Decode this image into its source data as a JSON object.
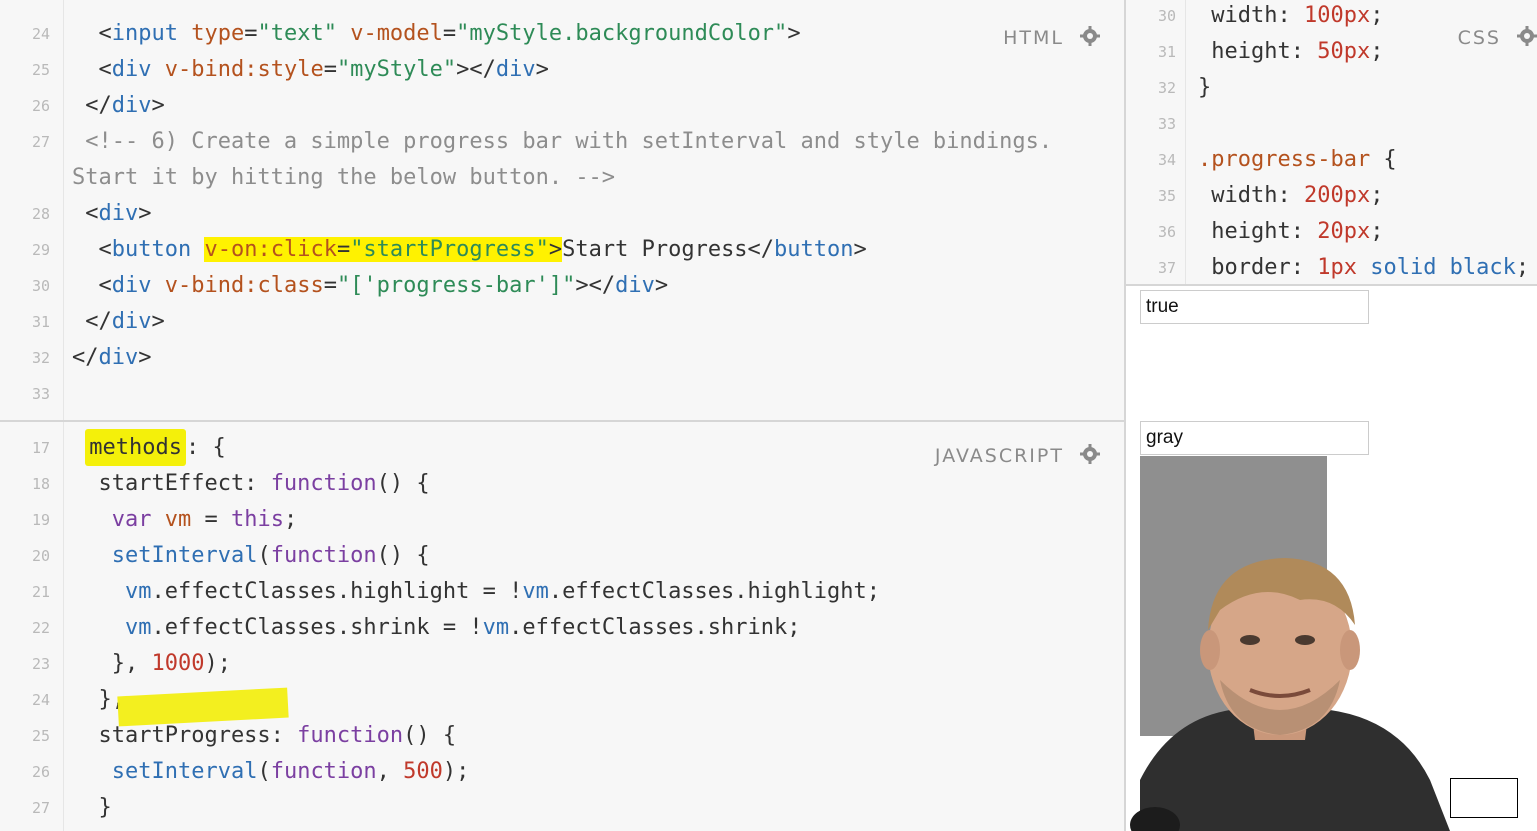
{
  "html_pane": {
    "label": "HTML",
    "lines": [
      {
        "num": "24",
        "segments": [
          {
            "t": "  <",
            "c": "tag"
          },
          {
            "t": "input",
            "c": "name"
          },
          {
            "t": " type",
            "c": "attr"
          },
          {
            "t": "=",
            "c": "plain"
          },
          {
            "t": "\"text\"",
            "c": "str"
          },
          {
            "t": " v-model",
            "c": "attr"
          },
          {
            "t": "=",
            "c": "plain"
          },
          {
            "t": "\"myStyle.backgroundColor\"",
            "c": "str"
          },
          {
            "t": ">",
            "c": "tag"
          }
        ]
      },
      {
        "num": "25",
        "segments": [
          {
            "t": "  <",
            "c": "tag"
          },
          {
            "t": "div",
            "c": "name"
          },
          {
            "t": " v-bind:style",
            "c": "attr"
          },
          {
            "t": "=",
            "c": "plain"
          },
          {
            "t": "\"myStyle\"",
            "c": "str"
          },
          {
            "t": "></",
            "c": "tag"
          },
          {
            "t": "div",
            "c": "name"
          },
          {
            "t": ">",
            "c": "tag"
          }
        ]
      },
      {
        "num": "26",
        "segments": [
          {
            "t": " </",
            "c": "tag"
          },
          {
            "t": "div",
            "c": "name"
          },
          {
            "t": ">",
            "c": "tag"
          }
        ]
      },
      {
        "num": "27",
        "segments": [
          {
            "t": " <!-- 6) Create a simple progress bar with setInterval and style bindings.",
            "c": "com"
          }
        ]
      },
      {
        "num": "",
        "segments": [
          {
            "t": "Start it by hitting the below button. -->",
            "c": "com"
          }
        ]
      },
      {
        "num": "28",
        "segments": [
          {
            "t": " <",
            "c": "tag"
          },
          {
            "t": "div",
            "c": "name"
          },
          {
            "t": ">",
            "c": "tag"
          }
        ]
      },
      {
        "num": "29",
        "segments": [
          {
            "t": "  <",
            "c": "tag"
          },
          {
            "t": "button",
            "c": "name"
          },
          {
            "t": " ",
            "c": "plain"
          },
          {
            "t": "v-on:click",
            "c": "attr",
            "hl": true
          },
          {
            "t": "=",
            "c": "plain",
            "hl": true
          },
          {
            "t": "\"startProgress\"",
            "c": "str",
            "hl": true
          },
          {
            "t": ">",
            "c": "tag",
            "hl": true
          },
          {
            "t": "Start Progress</",
            "c": "tag"
          },
          {
            "t": "button",
            "c": "name"
          },
          {
            "t": ">",
            "c": "tag"
          }
        ]
      },
      {
        "num": "30",
        "segments": [
          {
            "t": "  <",
            "c": "tag"
          },
          {
            "t": "div",
            "c": "name"
          },
          {
            "t": " v-bind:class",
            "c": "attr"
          },
          {
            "t": "=",
            "c": "plain"
          },
          {
            "t": "\"['progress-bar']\"",
            "c": "str"
          },
          {
            "t": "></",
            "c": "tag"
          },
          {
            "t": "div",
            "c": "name"
          },
          {
            "t": ">",
            "c": "tag"
          }
        ]
      },
      {
        "num": "31",
        "segments": [
          {
            "t": " </",
            "c": "tag"
          },
          {
            "t": "div",
            "c": "name"
          },
          {
            "t": ">",
            "c": "tag"
          }
        ]
      },
      {
        "num": "32",
        "segments": [
          {
            "t": "</",
            "c": "tag"
          },
          {
            "t": "div",
            "c": "name"
          },
          {
            "t": ">",
            "c": "tag"
          }
        ]
      },
      {
        "num": "33",
        "segments": []
      }
    ]
  },
  "js_pane": {
    "label": "JAVASCRIPT",
    "lines": [
      {
        "num": "17",
        "segments": [
          {
            "t": " ",
            "c": "plain"
          },
          {
            "t": "methods",
            "c": "plain",
            "hlm": true
          },
          {
            "t": ": {",
            "c": "plain"
          }
        ]
      },
      {
        "num": "18",
        "segments": [
          {
            "t": "  startEffect: ",
            "c": "plain"
          },
          {
            "t": "function",
            "c": "kw"
          },
          {
            "t": "() {",
            "c": "plain"
          }
        ]
      },
      {
        "num": "19",
        "segments": [
          {
            "t": "   ",
            "c": "plain"
          },
          {
            "t": "var",
            "c": "kw"
          },
          {
            "t": " vm",
            "c": "attr"
          },
          {
            "t": " = ",
            "c": "plain"
          },
          {
            "t": "this",
            "c": "kw"
          },
          {
            "t": ";",
            "c": "plain"
          }
        ]
      },
      {
        "num": "20",
        "segments": [
          {
            "t": "   ",
            "c": "plain"
          },
          {
            "t": "setInterval",
            "c": "var"
          },
          {
            "t": "(",
            "c": "plain"
          },
          {
            "t": "function",
            "c": "kw"
          },
          {
            "t": "() {",
            "c": "plain"
          }
        ]
      },
      {
        "num": "21",
        "segments": [
          {
            "t": "    ",
            "c": "plain"
          },
          {
            "t": "vm",
            "c": "var"
          },
          {
            "t": ".effectClasses.highlight = !",
            "c": "plain"
          },
          {
            "t": "vm",
            "c": "var"
          },
          {
            "t": ".effectClasses.highlight;",
            "c": "plain"
          }
        ]
      },
      {
        "num": "22",
        "segments": [
          {
            "t": "    ",
            "c": "plain"
          },
          {
            "t": "vm",
            "c": "var"
          },
          {
            "t": ".effectClasses.shrink = !",
            "c": "plain"
          },
          {
            "t": "vm",
            "c": "var"
          },
          {
            "t": ".effectClasses.shrink;",
            "c": "plain"
          }
        ]
      },
      {
        "num": "23",
        "segments": [
          {
            "t": "   }, ",
            "c": "plain"
          },
          {
            "t": "1000",
            "c": "num"
          },
          {
            "t": ");",
            "c": "plain"
          }
        ]
      },
      {
        "num": "24",
        "segments": [
          {
            "t": "  },",
            "c": "plain"
          }
        ]
      },
      {
        "num": "25",
        "segments": [
          {
            "t": "  startProgress: ",
            "c": "plain"
          },
          {
            "t": "function",
            "c": "kw"
          },
          {
            "t": "() {",
            "c": "plain"
          }
        ]
      },
      {
        "num": "26",
        "segments": [
          {
            "t": "   ",
            "c": "plain"
          },
          {
            "t": "setInterval",
            "c": "var"
          },
          {
            "t": "(",
            "c": "plain"
          },
          {
            "t": "function",
            "c": "kw"
          },
          {
            "t": ", ",
            "c": "plain"
          },
          {
            "t": "500",
            "c": "num"
          },
          {
            "t": ");",
            "c": "plain"
          }
        ]
      },
      {
        "num": "27",
        "segments": [
          {
            "t": "  }",
            "c": "plain"
          }
        ]
      }
    ]
  },
  "css_pane": {
    "label": "CSS",
    "lines": [
      {
        "num": "30",
        "segments": [
          {
            "t": " width: ",
            "c": "plain"
          },
          {
            "t": "100px",
            "c": "num"
          },
          {
            "t": ";",
            "c": "plain"
          }
        ]
      },
      {
        "num": "31",
        "segments": [
          {
            "t": " height: ",
            "c": "plain"
          },
          {
            "t": "50px",
            "c": "num"
          },
          {
            "t": ";",
            "c": "plain"
          }
        ]
      },
      {
        "num": "32",
        "segments": [
          {
            "t": "}",
            "c": "plain"
          }
        ]
      },
      {
        "num": "33",
        "segments": []
      },
      {
        "num": "34",
        "segments": [
          {
            "t": ".progress-bar",
            "c": "attr"
          },
          {
            "t": " {",
            "c": "plain"
          }
        ]
      },
      {
        "num": "35",
        "segments": [
          {
            "t": " width: ",
            "c": "plain"
          },
          {
            "t": "200px",
            "c": "num"
          },
          {
            "t": ";",
            "c": "plain"
          }
        ]
      },
      {
        "num": "36",
        "segments": [
          {
            "t": " height: ",
            "c": "plain"
          },
          {
            "t": "20px",
            "c": "num"
          },
          {
            "t": ";",
            "c": "plain"
          }
        ]
      },
      {
        "num": "37",
        "segments": [
          {
            "t": " border: ",
            "c": "plain"
          },
          {
            "t": "1px",
            "c": "num"
          },
          {
            "t": " solid black",
            "c": "name"
          },
          {
            "t": ";",
            "c": "plain"
          }
        ]
      }
    ]
  },
  "result_pane": {
    "input_true": "true",
    "input_gray": "gray",
    "box_color": "#8f8f8f"
  },
  "colors": {
    "highlight": "#fff200",
    "background": "#f7f7f7"
  },
  "icons": {
    "settings": "gear-icon"
  }
}
